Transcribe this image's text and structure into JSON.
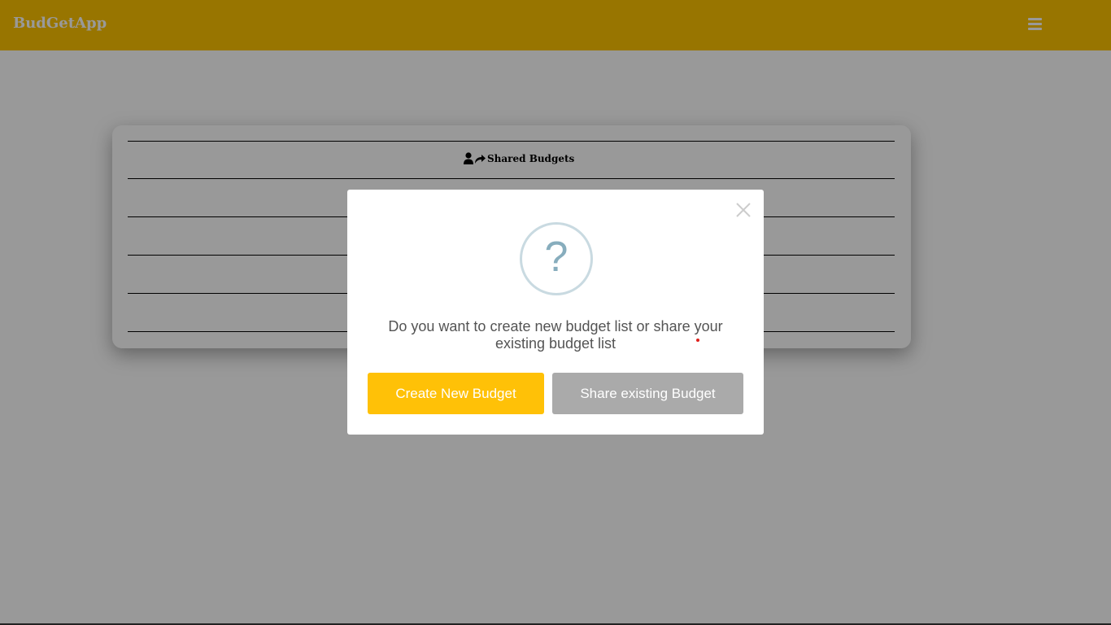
{
  "navbar": {
    "brand": "BudGetApp",
    "menu_icon": "hamburger-menu-icon",
    "color": "#fdc400"
  },
  "shared_budgets": {
    "heading": "Shared Budgets",
    "icon": "user-share-icon"
  },
  "modal": {
    "icon": "question-mark-icon",
    "icon_glyph": "?",
    "message": "Do you want to create new budget list or share your existing budget list",
    "close_icon": "close-icon",
    "create_button_label": "Create New Budget",
    "share_button_label": "Share existing Budget",
    "create_button_color": "#ffc107",
    "share_button_color": "#aaaaaa"
  }
}
